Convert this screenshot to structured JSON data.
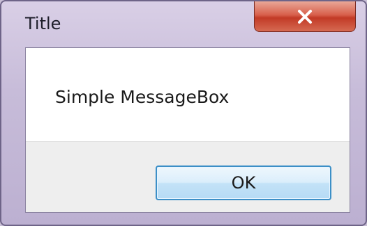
{
  "window": {
    "title": "Title"
  },
  "message": {
    "text": "Simple MessageBox"
  },
  "buttons": {
    "ok_label": "OK",
    "close_icon": "close-icon"
  },
  "colors": {
    "close_button": "#c9432f",
    "ok_border": "#3c8fc7"
  }
}
